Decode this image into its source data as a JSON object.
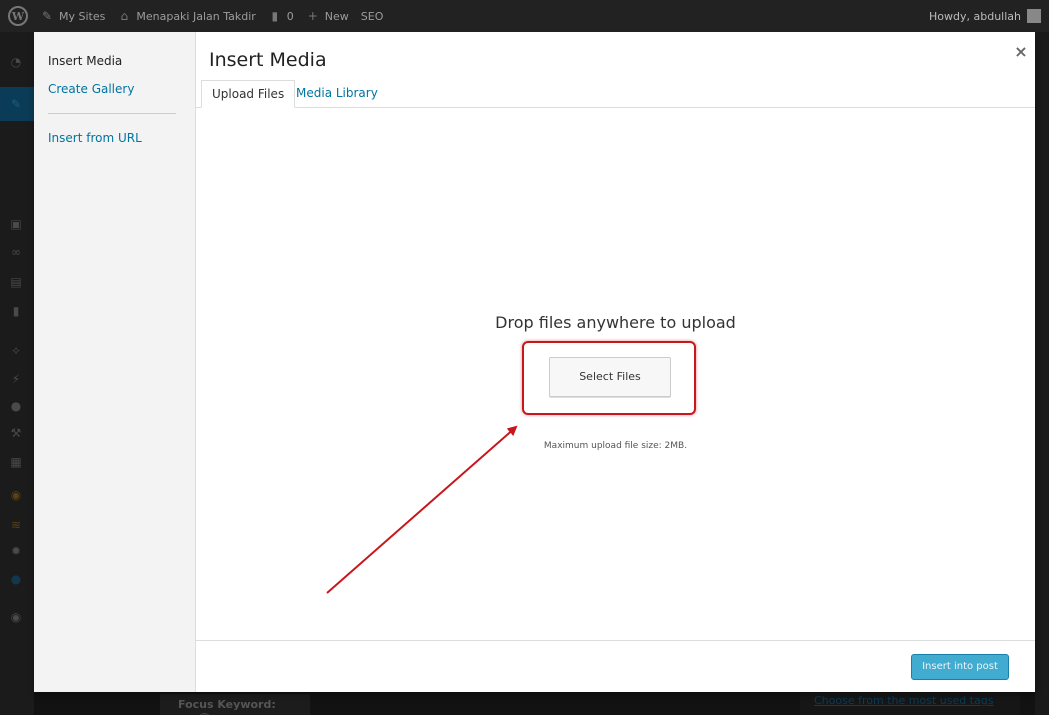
{
  "admin_bar": {
    "my_sites": "My Sites",
    "site_name": "Menapaki Jalan Takdir",
    "comments_count": "0",
    "new_label": "New",
    "seo_label": "SEO",
    "howdy": "Howdy, abdullah"
  },
  "media_menu": {
    "items": [
      {
        "label": "Insert Media",
        "active": true
      },
      {
        "label": "Create Gallery",
        "active": false
      },
      {
        "label": "Insert from URL",
        "active": false
      }
    ]
  },
  "modal": {
    "title": "Insert Media",
    "close_icon": "×",
    "tabs": [
      {
        "label": "Upload Files",
        "active": true
      },
      {
        "label": "Media Library",
        "active": false
      }
    ],
    "drop_text": "Drop files anywhere to upload",
    "select_files_label": "Select Files",
    "max_upload": "Maximum upload file size: 2MB.",
    "insert_button": "Insert into post"
  },
  "background_page": {
    "focus_keyword_label": "Focus Keyword:",
    "help_icon": "?",
    "tags_link": "Choose from the most used tags"
  },
  "colors": {
    "link": "#0074a2",
    "primary_button": "#2ea2cc",
    "annotation": "#c8161d"
  }
}
